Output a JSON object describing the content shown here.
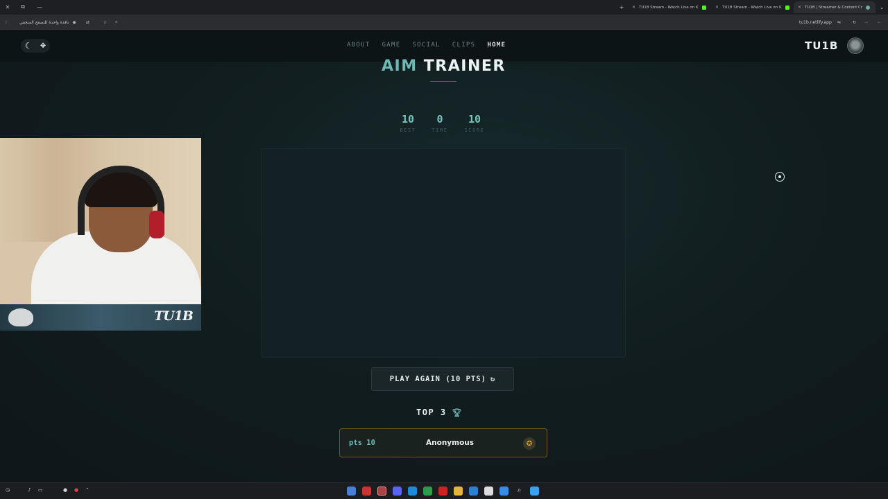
{
  "browser": {
    "tabs": [
      {
        "title": "TU18 Stream - Watch Live on K",
        "active": false
      },
      {
        "title": "TU18 Stream - Watch Live on K",
        "active": false
      },
      {
        "title": "TU1B | Streamer & Content Cr",
        "active": true
      }
    ],
    "incognito_label": "نافذة واحدة للتصفح المتخفي",
    "url": "tu1b.netlify.app"
  },
  "nav": {
    "links": [
      "ABOUT",
      "GAME",
      "SOCIAL",
      "CLIPS",
      "HOME"
    ],
    "active": "HOME",
    "brand": "TU1B"
  },
  "game": {
    "title_accent": "AIM",
    "title_rest": "TRAINER",
    "stats": [
      {
        "value": "10",
        "label": "BEST"
      },
      {
        "value": "0",
        "label": "TIME"
      },
      {
        "value": "10",
        "label": "SCORE"
      }
    ],
    "play_again_label": "PLAY AGAIN (10 PTS)",
    "leaderboard_title": "TOP 3",
    "leaderboard": [
      {
        "points": "pts 10",
        "name": "Anonymous"
      }
    ]
  },
  "webcam": {
    "overlay_name": "TU1B"
  },
  "colors": {
    "accent": "#6fb8b6",
    "background": "#0f1719",
    "medal_border": "#6b5b1a"
  }
}
